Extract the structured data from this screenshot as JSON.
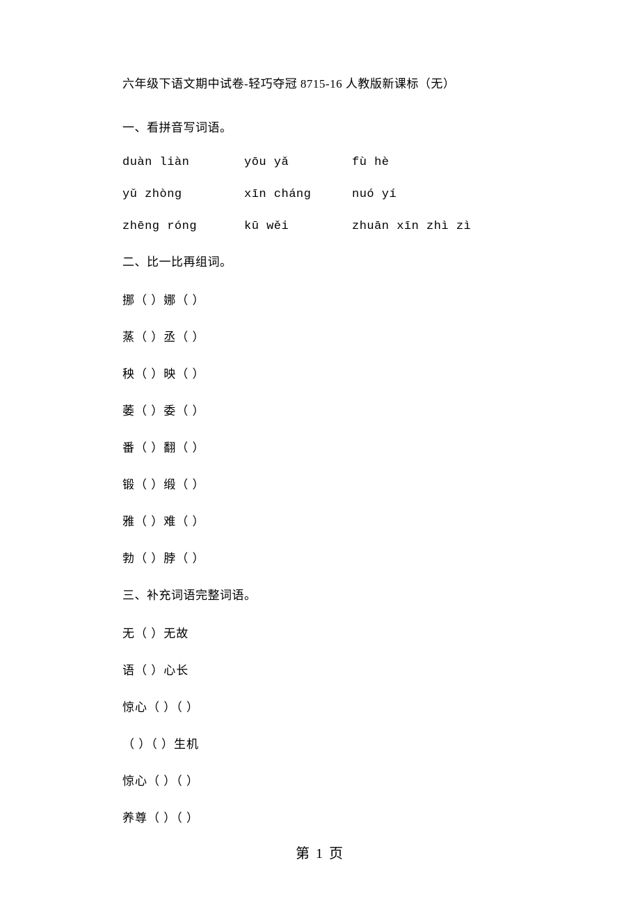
{
  "title": "六年级下语文期中试卷-轻巧夺冠 8715-16 人教版新课标（无）",
  "section1": {
    "heading": "一、看拼音写词语。",
    "rows": [
      {
        "c1": "duàn liàn",
        "c2": "yōu yǎ",
        "c3": "fù hè"
      },
      {
        "c1": "yǔ zhòng",
        "c2": "xīn cháng",
        "c3": "nuó yí"
      },
      {
        "c1": "zhēng róng",
        "c2": "kū wěi",
        "c3": "zhuān xīn zhì zì"
      }
    ]
  },
  "section2": {
    "heading": "二、比一比再组词。",
    "items": [
      "挪（ ）娜（ ）",
      "蒸（ ）丞（ ）",
      "秧（ ）映（ ）",
      "萎（ ）委（ ）",
      "番（ ）翻（ ）",
      "锻（ ）缎（ ）",
      "雅（ ）难（ ）",
      "勃（ ）脖（ ）"
    ]
  },
  "section3": {
    "heading": "三、补充词语完整词语。",
    "items": [
      "无（ ）无故",
      "语（ ）心长",
      "惊心（ ）（ ）",
      "（ ）（ ）生机",
      "惊心（ ）（ ）",
      "养尊（ ）（ ）"
    ]
  },
  "footer": "第 1 页"
}
